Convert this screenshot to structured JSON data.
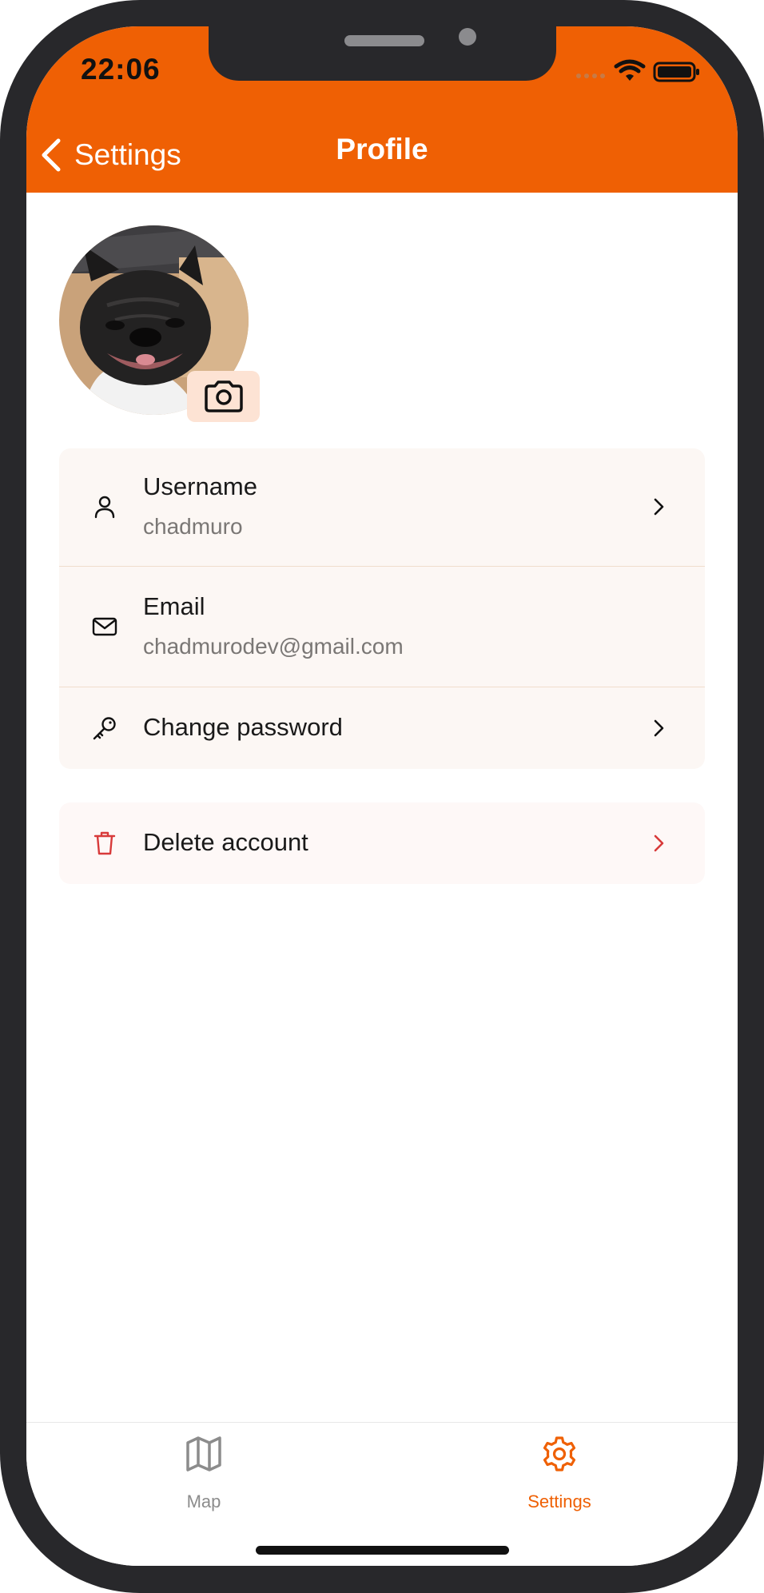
{
  "status_bar": {
    "time": "22:06"
  },
  "nav": {
    "back_label": "Settings",
    "title": "Profile"
  },
  "profile": {
    "avatar_icon": "french-bulldog-photo",
    "camera_icon": "camera-icon"
  },
  "account_rows": [
    {
      "icon": "user-icon",
      "title": "Username",
      "value": "chadmuro",
      "has_chevron": true
    },
    {
      "icon": "mail-icon",
      "title": "Email",
      "value": "chadmurodev@gmail.com",
      "has_chevron": false
    },
    {
      "icon": "key-icon",
      "title": "Change password",
      "has_chevron": true
    }
  ],
  "danger_row": {
    "icon": "trash-icon",
    "title": "Delete account"
  },
  "tab_bar": {
    "tabs": [
      {
        "label": "Map",
        "icon": "map-icon",
        "active": false
      },
      {
        "label": "Settings",
        "icon": "gear-icon",
        "active": true
      }
    ]
  },
  "colors": {
    "brand": "#ef6004",
    "danger": "#d83a3a",
    "card_bg": "#fcf7f4",
    "camera_bg": "#fde3d4",
    "inactive_tab": "#8c8c8c"
  }
}
